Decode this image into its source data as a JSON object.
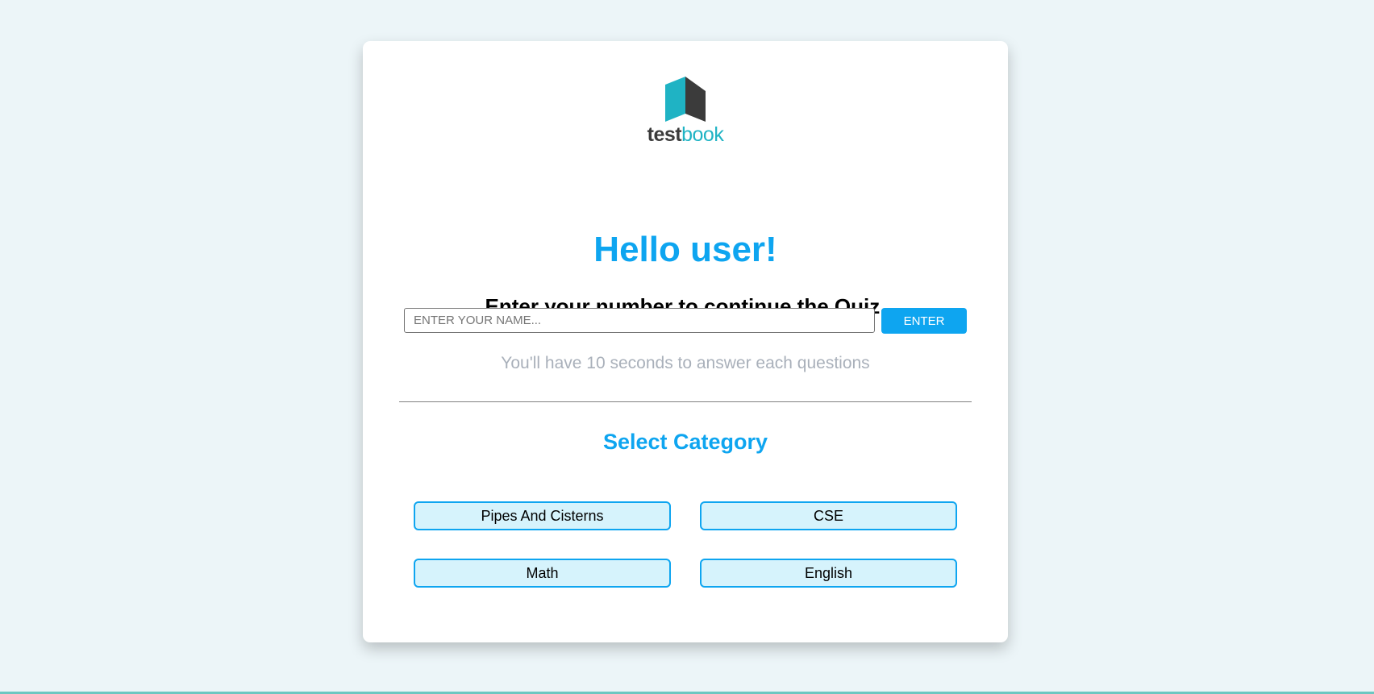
{
  "logo": {
    "text_part1": "test",
    "text_part2": "book"
  },
  "greeting": "Hello user!",
  "instruction": "Enter your number to continue the Quiz.",
  "name_input": {
    "value": "",
    "placeholder": "ENTER YOUR NAME..."
  },
  "enter_button_label": "ENTER",
  "hint": "You'll have 10 seconds to answer each questions",
  "category_title": "Select Category",
  "categories": [
    {
      "label": "Pipes And Cisterns"
    },
    {
      "label": "CSE"
    },
    {
      "label": "Math"
    },
    {
      "label": "English"
    }
  ],
  "colors": {
    "accent": "#0ea5f0",
    "category_bg": "#d6f3fc",
    "page_bg": "#ecf5f8",
    "logo_teal": "#1fb3c4",
    "logo_dark": "#3b3b3b"
  },
  "icons": {
    "logo": "testbook-book-icon"
  }
}
